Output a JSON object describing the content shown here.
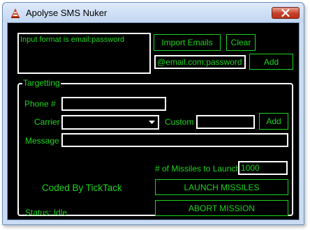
{
  "window": {
    "title": "Apolyse SMS Nuker",
    "icons": {
      "app": "warning-cone-icon",
      "close": "close-icon"
    }
  },
  "input_area": {
    "text": "Input format is email:password"
  },
  "buttons": {
    "import_emails": "Import Emails",
    "clear": "Clear",
    "add_email": "Add",
    "add_carrier": "Add",
    "launch": "LAUNCH MISSILES",
    "abort": "ABORT MISSION"
  },
  "email_field": {
    "value": "@email.com:password"
  },
  "targetting": {
    "legend": "Targetting",
    "phone_label": "Phone #",
    "phone_value": "",
    "carrier_label": "Carrier",
    "carrier_value": "",
    "custom_label": "Custom",
    "custom_value": "",
    "message_label": "Message",
    "message_value": ""
  },
  "missiles": {
    "label": "# of Missiles to Launch",
    "value": "1000"
  },
  "credit": "Coded By TickTack",
  "status": "Status: Idle",
  "colors": {
    "accent": "#1dd61d",
    "background": "#000000",
    "field_border": "#ffffff"
  }
}
